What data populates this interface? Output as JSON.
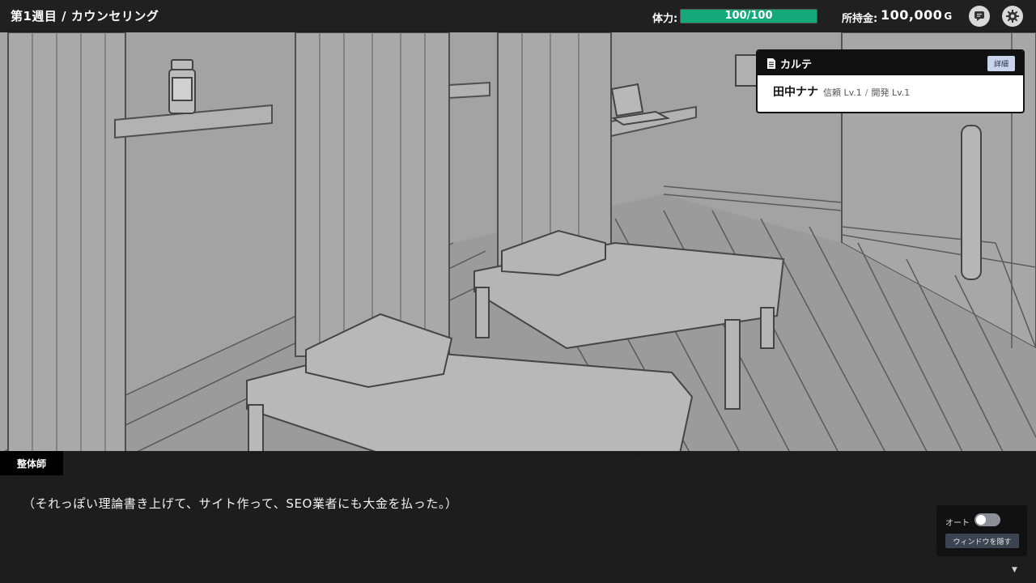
{
  "header": {
    "chapter": "第1週目 / カウンセリング",
    "stamina_label": "体力:",
    "stamina_text": "100/100",
    "stamina_ratio": 1.0,
    "money_label": "所持金:",
    "money_value": "100,000",
    "money_unit": "G"
  },
  "icons": {
    "message": "chat-bubble-icon",
    "settings": "gear-icon",
    "document": "document-icon"
  },
  "karte": {
    "title": "カルテ",
    "detail_label": "詳細",
    "patient_name": "田中ナナ",
    "trust": "信頼 Lv.1",
    "separator": "/",
    "development": "開発 Lv.1"
  },
  "dialog": {
    "speaker": "整体師",
    "text": "（それっぽい理論書き上げて、サイト作って、SEO業者にも大金を払った。）",
    "auto_label": "オート",
    "auto_on": false,
    "hide_window_label": "ウィンドウを隠す",
    "next_indicator": "▼"
  },
  "colors": {
    "stamina": "#15a87a",
    "detail_button": "#c9d4ea",
    "hide_button": "#3c4452"
  }
}
